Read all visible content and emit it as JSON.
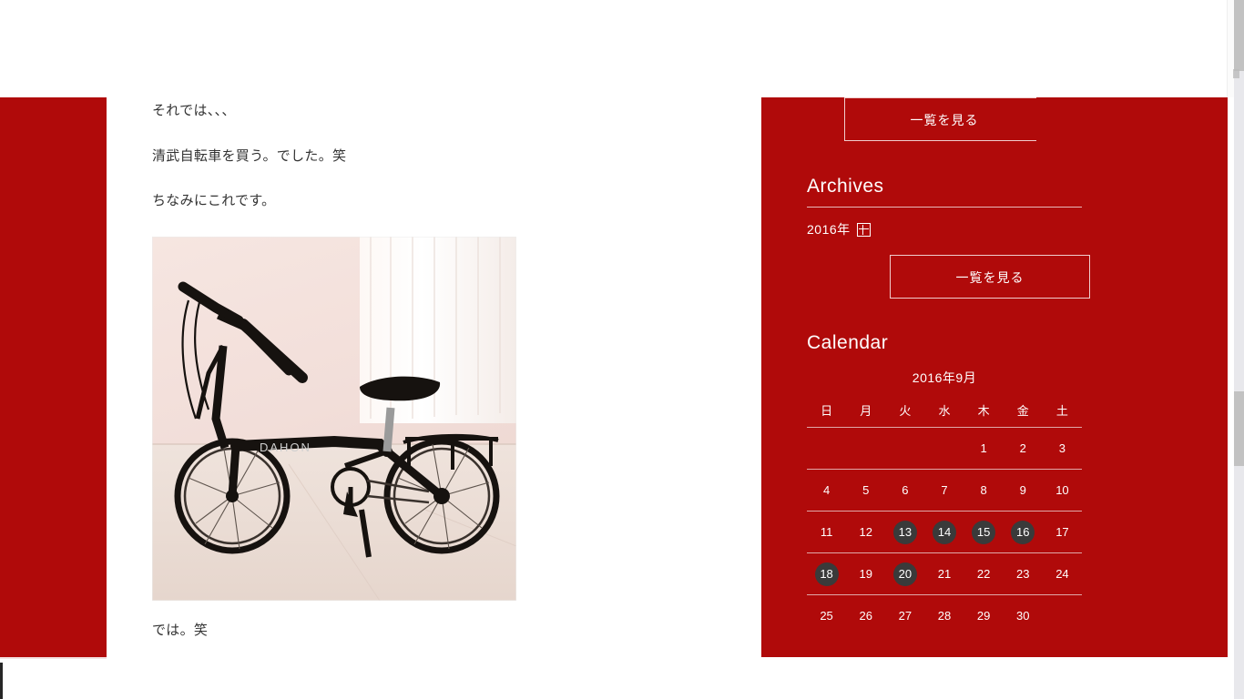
{
  "theme": {
    "brand_red": "#b00a0a",
    "sidebar_rule": "#e0a8a8",
    "highlight_badge": "#3a3a3a",
    "body_text": "#333333"
  },
  "article": {
    "paragraphs": [
      "それでは、、、",
      "清武自転車を買う。でした。笑",
      "ちなみにこれです。"
    ],
    "closing": "では。笑",
    "photo_alt": "DAHON 折りたたみ自転車"
  },
  "sidebar": {
    "top_button_label": "一覧を見る",
    "archives": {
      "title": "Archives",
      "entries": [
        {
          "label": "2016年",
          "expand_icon": "plus-box-icon"
        }
      ],
      "button_label": "一覧を見る"
    },
    "calendar": {
      "title": "Calendar",
      "caption": "2016年9月",
      "weekday_headers": [
        "日",
        "月",
        "火",
        "水",
        "木",
        "金",
        "土"
      ],
      "weeks": [
        [
          "",
          "",
          "",
          "",
          "1",
          "2",
          "3"
        ],
        [
          "4",
          "5",
          "6",
          "7",
          "8",
          "9",
          "10"
        ],
        [
          "11",
          "12",
          "13",
          "14",
          "15",
          "16",
          "17"
        ],
        [
          "18",
          "19",
          "20",
          "21",
          "22",
          "23",
          "24"
        ],
        [
          "25",
          "26",
          "27",
          "28",
          "29",
          "30",
          ""
        ]
      ],
      "highlighted_days": [
        "13",
        "14",
        "15",
        "16",
        "18",
        "20"
      ]
    }
  },
  "browser": {
    "scrollbar": "vertical-scrollbar",
    "cursor": "text-cursor"
  }
}
